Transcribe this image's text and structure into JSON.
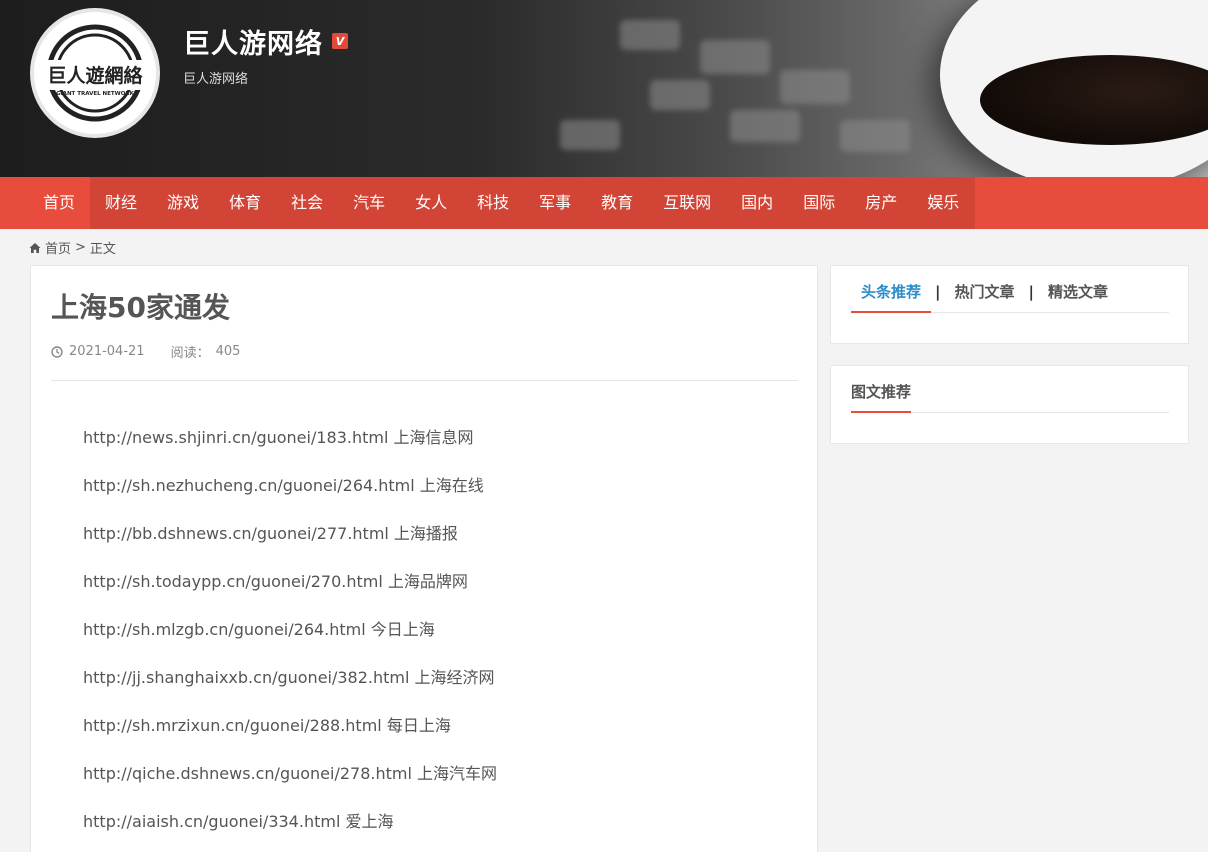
{
  "header": {
    "site_title": "巨人游网络",
    "verified_badge": "V",
    "site_subtitle": "巨人游网络",
    "logo_text": "巨人遊網絡",
    "logo_subtext": "GIANT TRAVEL NETWORK"
  },
  "nav": {
    "items": [
      "首页",
      "财经",
      "游戏",
      "体育",
      "社会",
      "汽车",
      "女人",
      "科技",
      "军事",
      "教育",
      "互联网",
      "国内",
      "国际",
      "房产",
      "娱乐"
    ],
    "active_index": 0,
    "color": "#e74c3c"
  },
  "breadcrumb": {
    "home": "首页",
    "separator": ">",
    "current": "正文"
  },
  "article": {
    "title": "上海50家通发",
    "date": "2021-04-21",
    "views_label": "阅读：",
    "views": "405",
    "lines": [
      "http://news.shjinri.cn/guonei/183.html 上海信息网",
      "http://sh.nezhucheng.cn/guonei/264.html 上海在线",
      "http://bb.dshnews.cn/guonei/277.html 上海播报",
      "http://sh.todaypp.cn/guonei/270.html 上海品牌网",
      "http://sh.mlzgb.cn/guonei/264.html 今日上海",
      "http://jj.shanghaixxb.cn/guonei/382.html 上海经济网",
      "http://sh.mrzixun.cn/guonei/288.html 每日上海",
      "http://qiche.dshnews.cn/guonei/278.html 上海汽车网",
      "http://aiaish.cn/guonei/334.html 爱上海"
    ]
  },
  "sidebar": {
    "tabs": [
      "头条推荐",
      "热门文章",
      "精选文章"
    ],
    "tab_separator": "|",
    "widget2_title": "图文推荐",
    "active_tab_color": "#2c8ec9"
  }
}
